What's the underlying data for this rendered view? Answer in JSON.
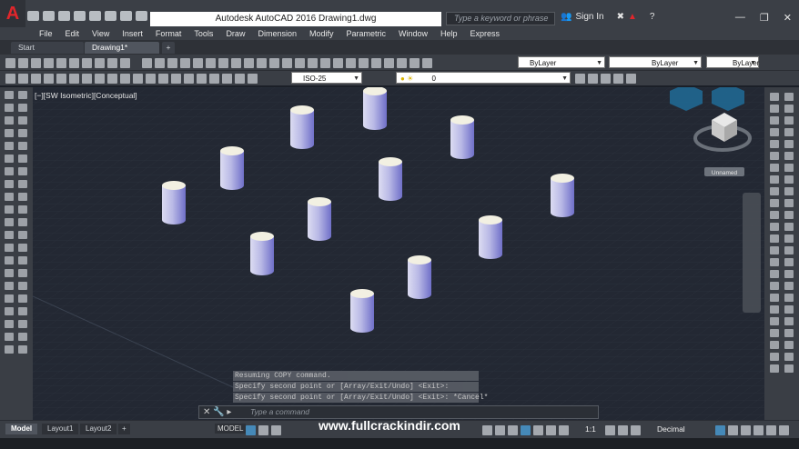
{
  "titlebar": {
    "app_logo": "A",
    "window_title": "Autodesk AutoCAD 2016    Drawing1.dwg",
    "search_placeholder": "Type a keyword or phrase",
    "sign_in": "Sign In",
    "help": "?",
    "minimize": "—",
    "restore": "❐",
    "close": "✕"
  },
  "menu": [
    "File",
    "Edit",
    "View",
    "Insert",
    "Format",
    "Tools",
    "Draw",
    "Dimension",
    "Modify",
    "Parametric",
    "Window",
    "Help",
    "Express"
  ],
  "filetabs": {
    "start": "Start",
    "drawing": "Drawing1*",
    "new": "+"
  },
  "toolbar": {
    "layer_color": "ByLayer",
    "linetype": "ByLayer",
    "lineweight": "ByLayer",
    "dim_style": "ISO-25",
    "layer": "0"
  },
  "viewport": {
    "label": "[−][SW Isometric][Conceptual]",
    "viewcube_label": "Unnamed"
  },
  "command": {
    "history": [
      "Resuming COPY command.",
      "Specify second point or [Array/Exit/Undo] <Exit>:",
      "Specify second point or [Array/Exit/Undo] <Exit>: *Cancel*"
    ],
    "placeholder": "Type a command"
  },
  "status": {
    "layout_tabs": [
      "Model",
      "Layout1",
      "Layout2"
    ],
    "add_layout": "+",
    "model_button": "MODEL",
    "scale": "1:1",
    "units": "Decimal"
  },
  "watermark": "www.fullcrackindir.com",
  "colors": {
    "canvas": "#232833",
    "panel": "#3a3e45",
    "accent_red": "#e0262b",
    "cylinder_top": "#f2f0e2",
    "cylinder_side": "#7b7bd0"
  }
}
